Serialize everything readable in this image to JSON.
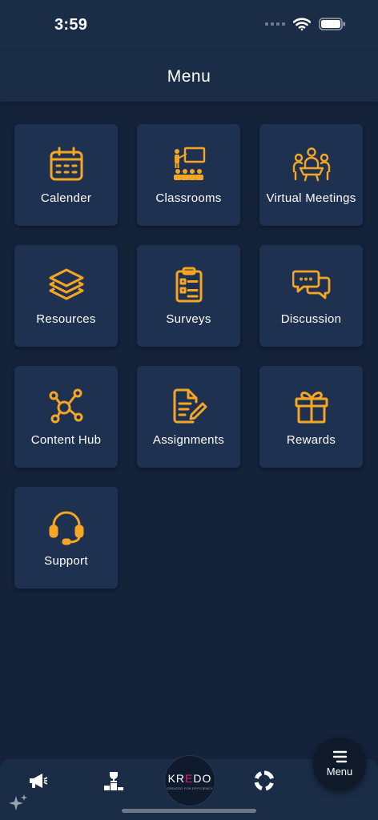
{
  "status_bar": {
    "time": "3:59"
  },
  "header": {
    "title": "Menu"
  },
  "accent_color": "#f6a623",
  "menu_items": [
    {
      "label": "Calender",
      "icon": "calendar-icon"
    },
    {
      "label": "Classrooms",
      "icon": "classroom-icon"
    },
    {
      "label": "Virtual Meetings",
      "icon": "meeting-icon"
    },
    {
      "label": "Resources",
      "icon": "layers-icon"
    },
    {
      "label": "Surveys",
      "icon": "clipboard-icon"
    },
    {
      "label": "Discussion",
      "icon": "chat-bubbles-icon"
    },
    {
      "label": "Content Hub",
      "icon": "hub-network-icon"
    },
    {
      "label": "Assignments",
      "icon": "document-edit-icon"
    },
    {
      "label": "Rewards",
      "icon": "gift-icon"
    },
    {
      "label": "Support",
      "icon": "headset-icon"
    }
  ],
  "bottom_nav": {
    "items": [
      {
        "icon": "megaphone-icon"
      },
      {
        "icon": "podium-trophy-icon"
      },
      {
        "icon": "brand-logo",
        "brand_text": "KREDO",
        "brand_tagline": "CREATED FOR EFFICIENCY"
      },
      {
        "icon": "progress-ring-icon"
      }
    ],
    "menu_label": "Menu"
  }
}
